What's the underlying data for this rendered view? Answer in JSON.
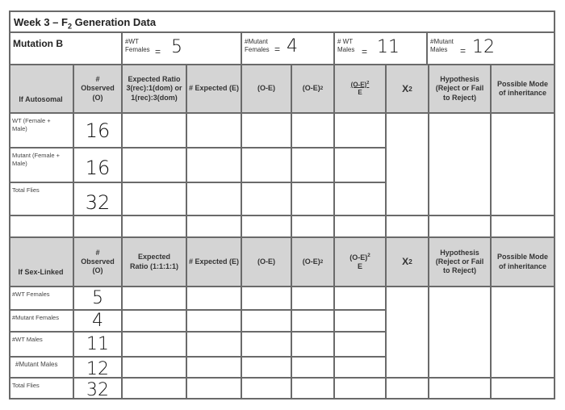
{
  "title": {
    "prefix": "Week 3 – F",
    "sub": "2",
    "suffix": " Generation Data"
  },
  "summary": {
    "label": "Mutation B",
    "counts": [
      {
        "label_line1": "#WT",
        "label_line2": "Females",
        "eq": "=",
        "value": "5"
      },
      {
        "label_line1": "#Mutant",
        "label_line2": "Females",
        "eq": "=",
        "value": "4"
      },
      {
        "label_line1": "# WT",
        "label_line2": "Males",
        "eq": "=",
        "value": "11"
      },
      {
        "label_line1": "#Mutant",
        "label_line2": "Males",
        "eq": "=",
        "value": "12"
      }
    ]
  },
  "autosomal": {
    "headers": {
      "category": "If Autosomal",
      "observed": "# Observed (O)",
      "ratio": "Expected Ratio 3(rec):1(dom) or 1(rec):3(dom)",
      "expected": "# Expected (E)",
      "o_minus_e": "(O-E)",
      "o_minus_e_sq": "(O-E)",
      "o_minus_e_sq_over_e_num": "(O-E)",
      "o_minus_e_sq_over_e_den": "E",
      "chi": "X",
      "sup": "2",
      "hypothesis": "Hypothesis (Reject or Fail to Reject)",
      "mode": "Possible Mode of inheritance"
    },
    "rows": [
      {
        "label": "WT (Female + Male)",
        "observed": "16"
      },
      {
        "label": "Mutant (Female + Male)",
        "observed": "16"
      },
      {
        "label": "Total Flies",
        "observed": "32"
      }
    ]
  },
  "sexlinked": {
    "headers": {
      "category": "If Sex-Linked",
      "observed": "# Observed (O)",
      "ratio": "Expected Ratio (1:1:1:1)",
      "expected": "# Expected (E)",
      "o_minus_e": "(O-E)",
      "o_minus_e_sq": "(O-E)",
      "o_minus_e_sq_over_e_num": "(O-E)",
      "o_minus_e_sq_over_e_den": "E",
      "chi": "X",
      "sup": "2",
      "hypothesis": "Hypothesis (Reject or Fail to Reject)",
      "mode": "Possible Mode of inheritance"
    },
    "rows": [
      {
        "label": "#WT Females",
        "observed": "5"
      },
      {
        "label": "#Mutant Females",
        "observed": "4"
      },
      {
        "label": "#WT Males",
        "observed": "11"
      },
      {
        "label": "#Mutant Males",
        "observed": "12"
      },
      {
        "label": "Total Flies",
        "observed": "32"
      }
    ]
  }
}
